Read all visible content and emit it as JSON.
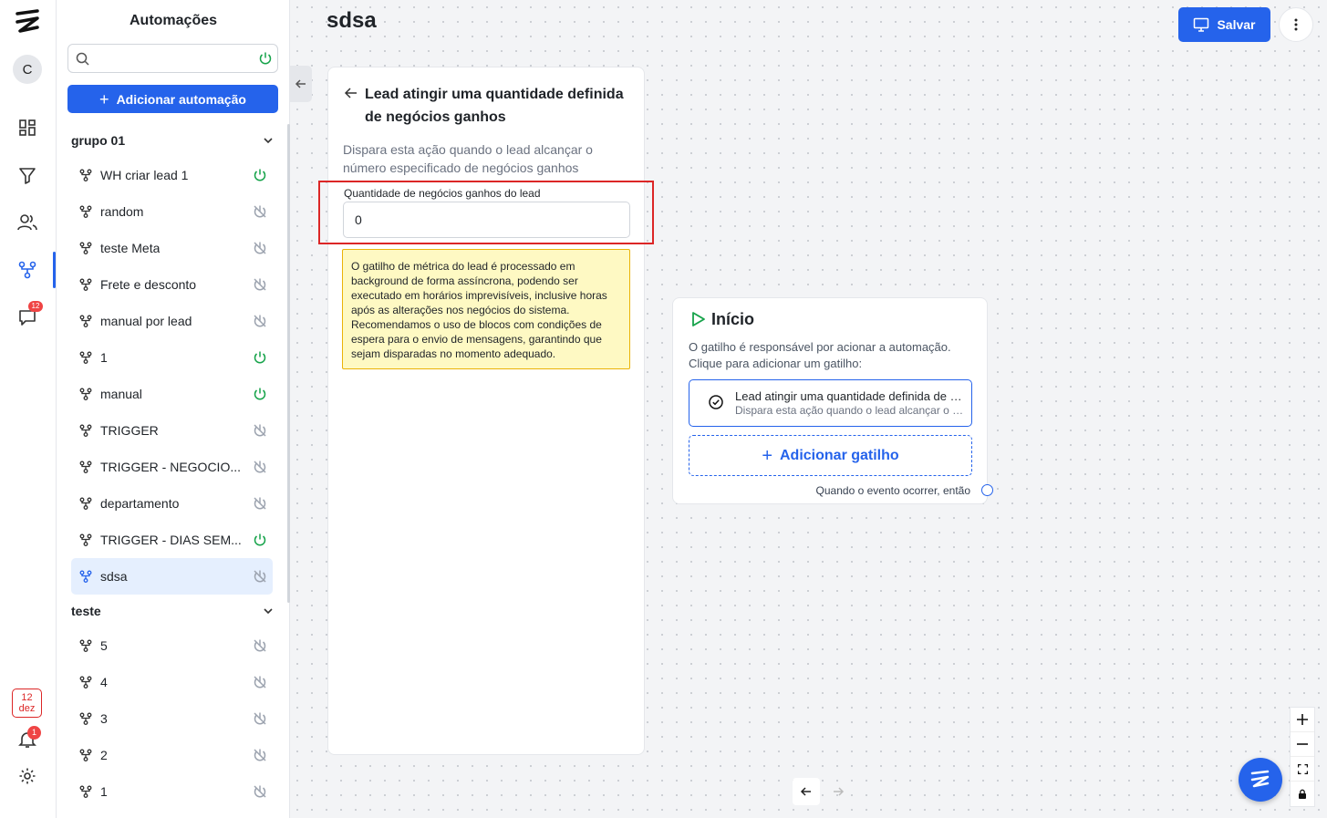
{
  "rail": {
    "avatar_initial": "C",
    "chat_badge": "12",
    "date_day": "12",
    "date_month": "dez",
    "notif_badge": "1",
    "icons": [
      "dashboard-icon",
      "filter-icon",
      "users-icon",
      "automation-icon",
      "chat-icon",
      "bell-icon",
      "settings-icon"
    ]
  },
  "sidebar": {
    "title": "Automações",
    "search_placeholder": "",
    "add_label": "Adicionar automação",
    "groups": [
      {
        "name": "grupo 01",
        "items": [
          {
            "label": "WH criar lead 1",
            "active": true
          },
          {
            "label": "random",
            "active": false
          },
          {
            "label": "teste Meta",
            "active": false
          },
          {
            "label": "Frete e desconto",
            "active": false
          },
          {
            "label": "manual por lead",
            "active": false
          },
          {
            "label": "1",
            "active": true
          },
          {
            "label": "manual",
            "active": true
          },
          {
            "label": "TRIGGER",
            "active": false
          },
          {
            "label": "TRIGGER - NEGOCIO...",
            "active": false
          },
          {
            "label": "departamento",
            "active": false
          },
          {
            "label": "TRIGGER - DIAS SEM...",
            "active": true
          },
          {
            "label": "sdsa",
            "active": false,
            "selected": true
          }
        ]
      },
      {
        "name": "teste",
        "items": [
          {
            "label": "5",
            "active": false
          },
          {
            "label": "4",
            "active": false
          },
          {
            "label": "3",
            "active": false
          },
          {
            "label": "2",
            "active": false
          },
          {
            "label": "1",
            "active": false
          }
        ]
      }
    ]
  },
  "page": {
    "title": "sdsa",
    "save_label": "Salvar"
  },
  "panel": {
    "title": "Lead atingir uma quantidade definida de negócios ganhos",
    "description": "Dispara esta ação quando o lead alcançar o número especificado de negócios ganhos",
    "field_label": "Quantidade de negócios ganhos do lead",
    "field_value": "0",
    "warning": "O gatilho de métrica do lead é processado em background de forma assíncrona, podendo ser executado em horários imprevisíveis, inclusive horas após as alterações nos negócios do sistema. Recomendamos o uso de blocos com condições de espera para o envio de mensagens, garantindo que sejam disparadas no momento adequado."
  },
  "node": {
    "title": "Início",
    "description": "O gatilho é responsável por acionar a automação. Clique para adicionar um gatilho:",
    "trigger_title": "Lead atingir uma quantidade definida de negócios ganhos",
    "trigger_desc": "Dispara esta ação quando o lead alcançar o número especificado de negócios ganhos",
    "add_trigger_label": "Adicionar gatilho",
    "footer": "Quando o evento ocorrer, então"
  },
  "colors": {
    "accent": "#2563eb",
    "active_power": "#16a34a",
    "inactive_power": "#9ca3af",
    "highlight": "#dc2626",
    "warning_bg": "#fef9c3"
  }
}
